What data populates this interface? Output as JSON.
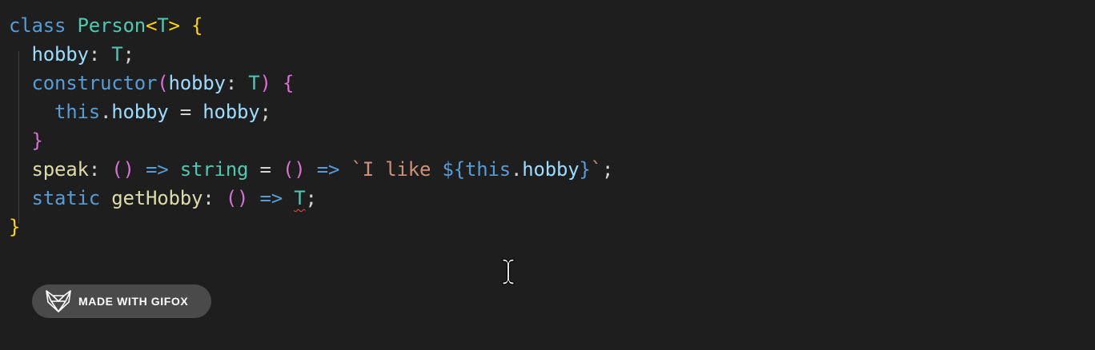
{
  "code": {
    "line1": {
      "kw": "class",
      "name": "Person",
      "lt": "<",
      "tparam": "T",
      "gt": ">",
      "brace": "{"
    },
    "line2": {
      "prop": "hobby",
      "colon": ":",
      "type": "T",
      "semi": ";"
    },
    "line3": {
      "kw": "constructor",
      "lparen": "(",
      "param": "hobby",
      "colon": ":",
      "type": "T",
      "rparen": ")",
      "brace": "{"
    },
    "line4": {
      "this": "this",
      "dot": ".",
      "prop": "hobby",
      "eq": "=",
      "value": "hobby",
      "semi": ";"
    },
    "line5": {
      "brace": "}"
    },
    "line6": {
      "fn": "speak",
      "colon": ":",
      "parens": "()",
      "arrow": "=>",
      "type": "string",
      "eq": "=",
      "parens2": "()",
      "arrow2": "=>",
      "tick_open": "`I like ",
      "interp_open": "${",
      "this": "this",
      "dot": ".",
      "prop": "hobby",
      "interp_close": "}",
      "tick_close": "`",
      "semi": ";"
    },
    "line7": {
      "kw": "static",
      "fn": "getHobby",
      "colon": ":",
      "parens": "()",
      "arrow": "=>",
      "type": "T",
      "semi": ";"
    },
    "line8": {
      "brace": "}"
    }
  },
  "badge": {
    "label": "MADE WITH GIFOX",
    "icon": "fox-icon"
  },
  "cursor": {
    "icon": "text-cursor-icon"
  },
  "colors": {
    "background": "#1e1e1e",
    "keyword": "#569cd6",
    "type": "#4ec9b0",
    "property": "#9cdcfe",
    "function": "#dcdcaa",
    "string": "#ce9178",
    "bracket_gold": "#ffd700",
    "bracket_purple": "#da70d6",
    "error_squiggle": "#f14c4c"
  }
}
